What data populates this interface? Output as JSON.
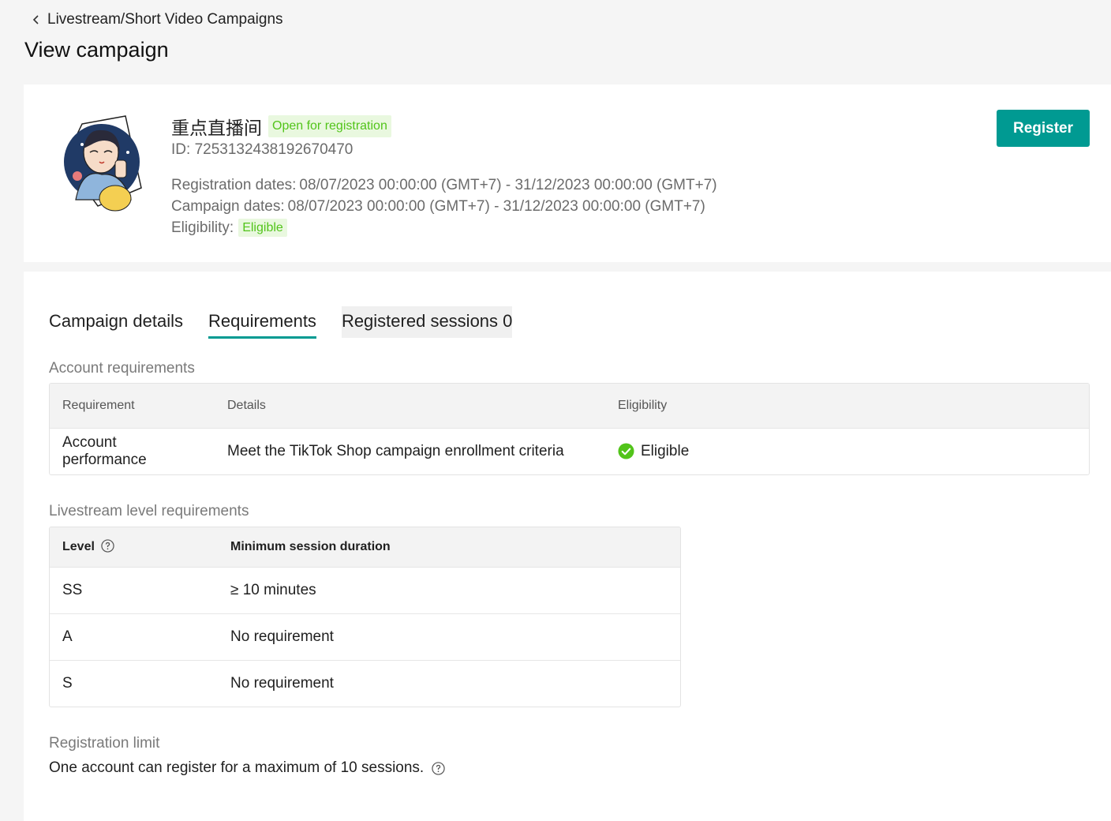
{
  "header": {
    "breadcrumb": "Livestream/Short Video Campaigns",
    "title": "View campaign"
  },
  "campaign": {
    "name": "重点直播间",
    "status": "Open for registration",
    "id_label": "ID:",
    "id_value": "7253132438192670470",
    "registration_label": "Registration dates:",
    "registration_value": "08/07/2023 00:00:00 (GMT+7) - 31/12/2023 00:00:00 (GMT+7)",
    "campaign_dates_label": "Campaign dates:",
    "campaign_dates_value": "08/07/2023 00:00:00 (GMT+7) - 31/12/2023 00:00:00 (GMT+7)",
    "eligibility_label": "Eligibility:",
    "eligibility_value": "Eligible",
    "register_button": "Register"
  },
  "tabs": [
    {
      "label": "Campaign details"
    },
    {
      "label": "Requirements"
    },
    {
      "label": "Registered sessions 0"
    }
  ],
  "account_requirements": {
    "title": "Account requirements",
    "columns": [
      "Requirement",
      "Details",
      "Eligibility"
    ],
    "rows": [
      {
        "requirement": "Account performance",
        "details": "Meet the TikTok Shop campaign enrollment criteria",
        "eligibility": "Eligible"
      }
    ]
  },
  "livestream_requirements": {
    "title": "Livestream level requirements",
    "columns": [
      "Level",
      "Minimum session duration"
    ],
    "rows": [
      {
        "level": "SS",
        "duration": "≥ 10 minutes"
      },
      {
        "level": "A",
        "duration": "No requirement"
      },
      {
        "level": "S",
        "duration": "No requirement"
      }
    ]
  },
  "registration_limit": {
    "title": "Registration limit",
    "text": "One account can register for a maximum of 10 sessions."
  },
  "colors": {
    "accent": "#009a92",
    "success": "#52c41a",
    "tag_bg": "#e9f8df"
  }
}
